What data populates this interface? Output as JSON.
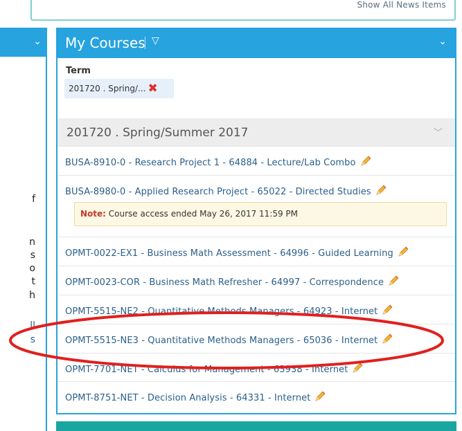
{
  "news": {
    "show_all_label": "Show All News Items"
  },
  "left_fragments": [
    "f",
    "n",
    "s",
    "o",
    "t",
    "h",
    "ll",
    "s"
  ],
  "courses_widget": {
    "title": "My Courses",
    "term": {
      "label": "Term",
      "selected_chip": "201720 . Spring/...",
      "remove_icon": "x-icon"
    },
    "group": {
      "title": "201720 . Spring/Summer 2017",
      "chevron_icon": "chevron-down-icon"
    },
    "note": {
      "label": "Note:",
      "text": " Course access ended May 26, 2017 11:59 PM"
    },
    "courses": [
      {
        "label": "BUSA-8910-0 - Research Project 1 - 64884 - Lecture/Lab Combo"
      },
      {
        "label": "BUSA-8980-0 - Applied Research Project - 65022 - Directed Studies"
      },
      {
        "label": "OPMT-0022-EX1 - Business Math Assessment - 64996 - Guided Learning"
      },
      {
        "label": "OPMT-0023-COR - Business Math Refresher - 64997 - Correspondence"
      },
      {
        "label": "OPMT-5515-NE2 - Quantitative Methods Managers - 64923 - Internet"
      },
      {
        "label": "OPMT-5515-NE3 - Quantitative Methods Managers - 65036 - Internet"
      },
      {
        "label": "OPMT-7701-NET - Calculus for Management - 63938 - Internet"
      },
      {
        "label": "OPMT-8751-NET - Decision Analysis - 64331 - Internet"
      }
    ]
  },
  "colors": {
    "header_blue": "#27a3df",
    "link": "#2a5f8a",
    "highlight_ellipse": "#e0201e",
    "remove_red": "#e0302b",
    "note_bg": "#fdf8e4",
    "bottom_teal": "#1aa6a0"
  }
}
